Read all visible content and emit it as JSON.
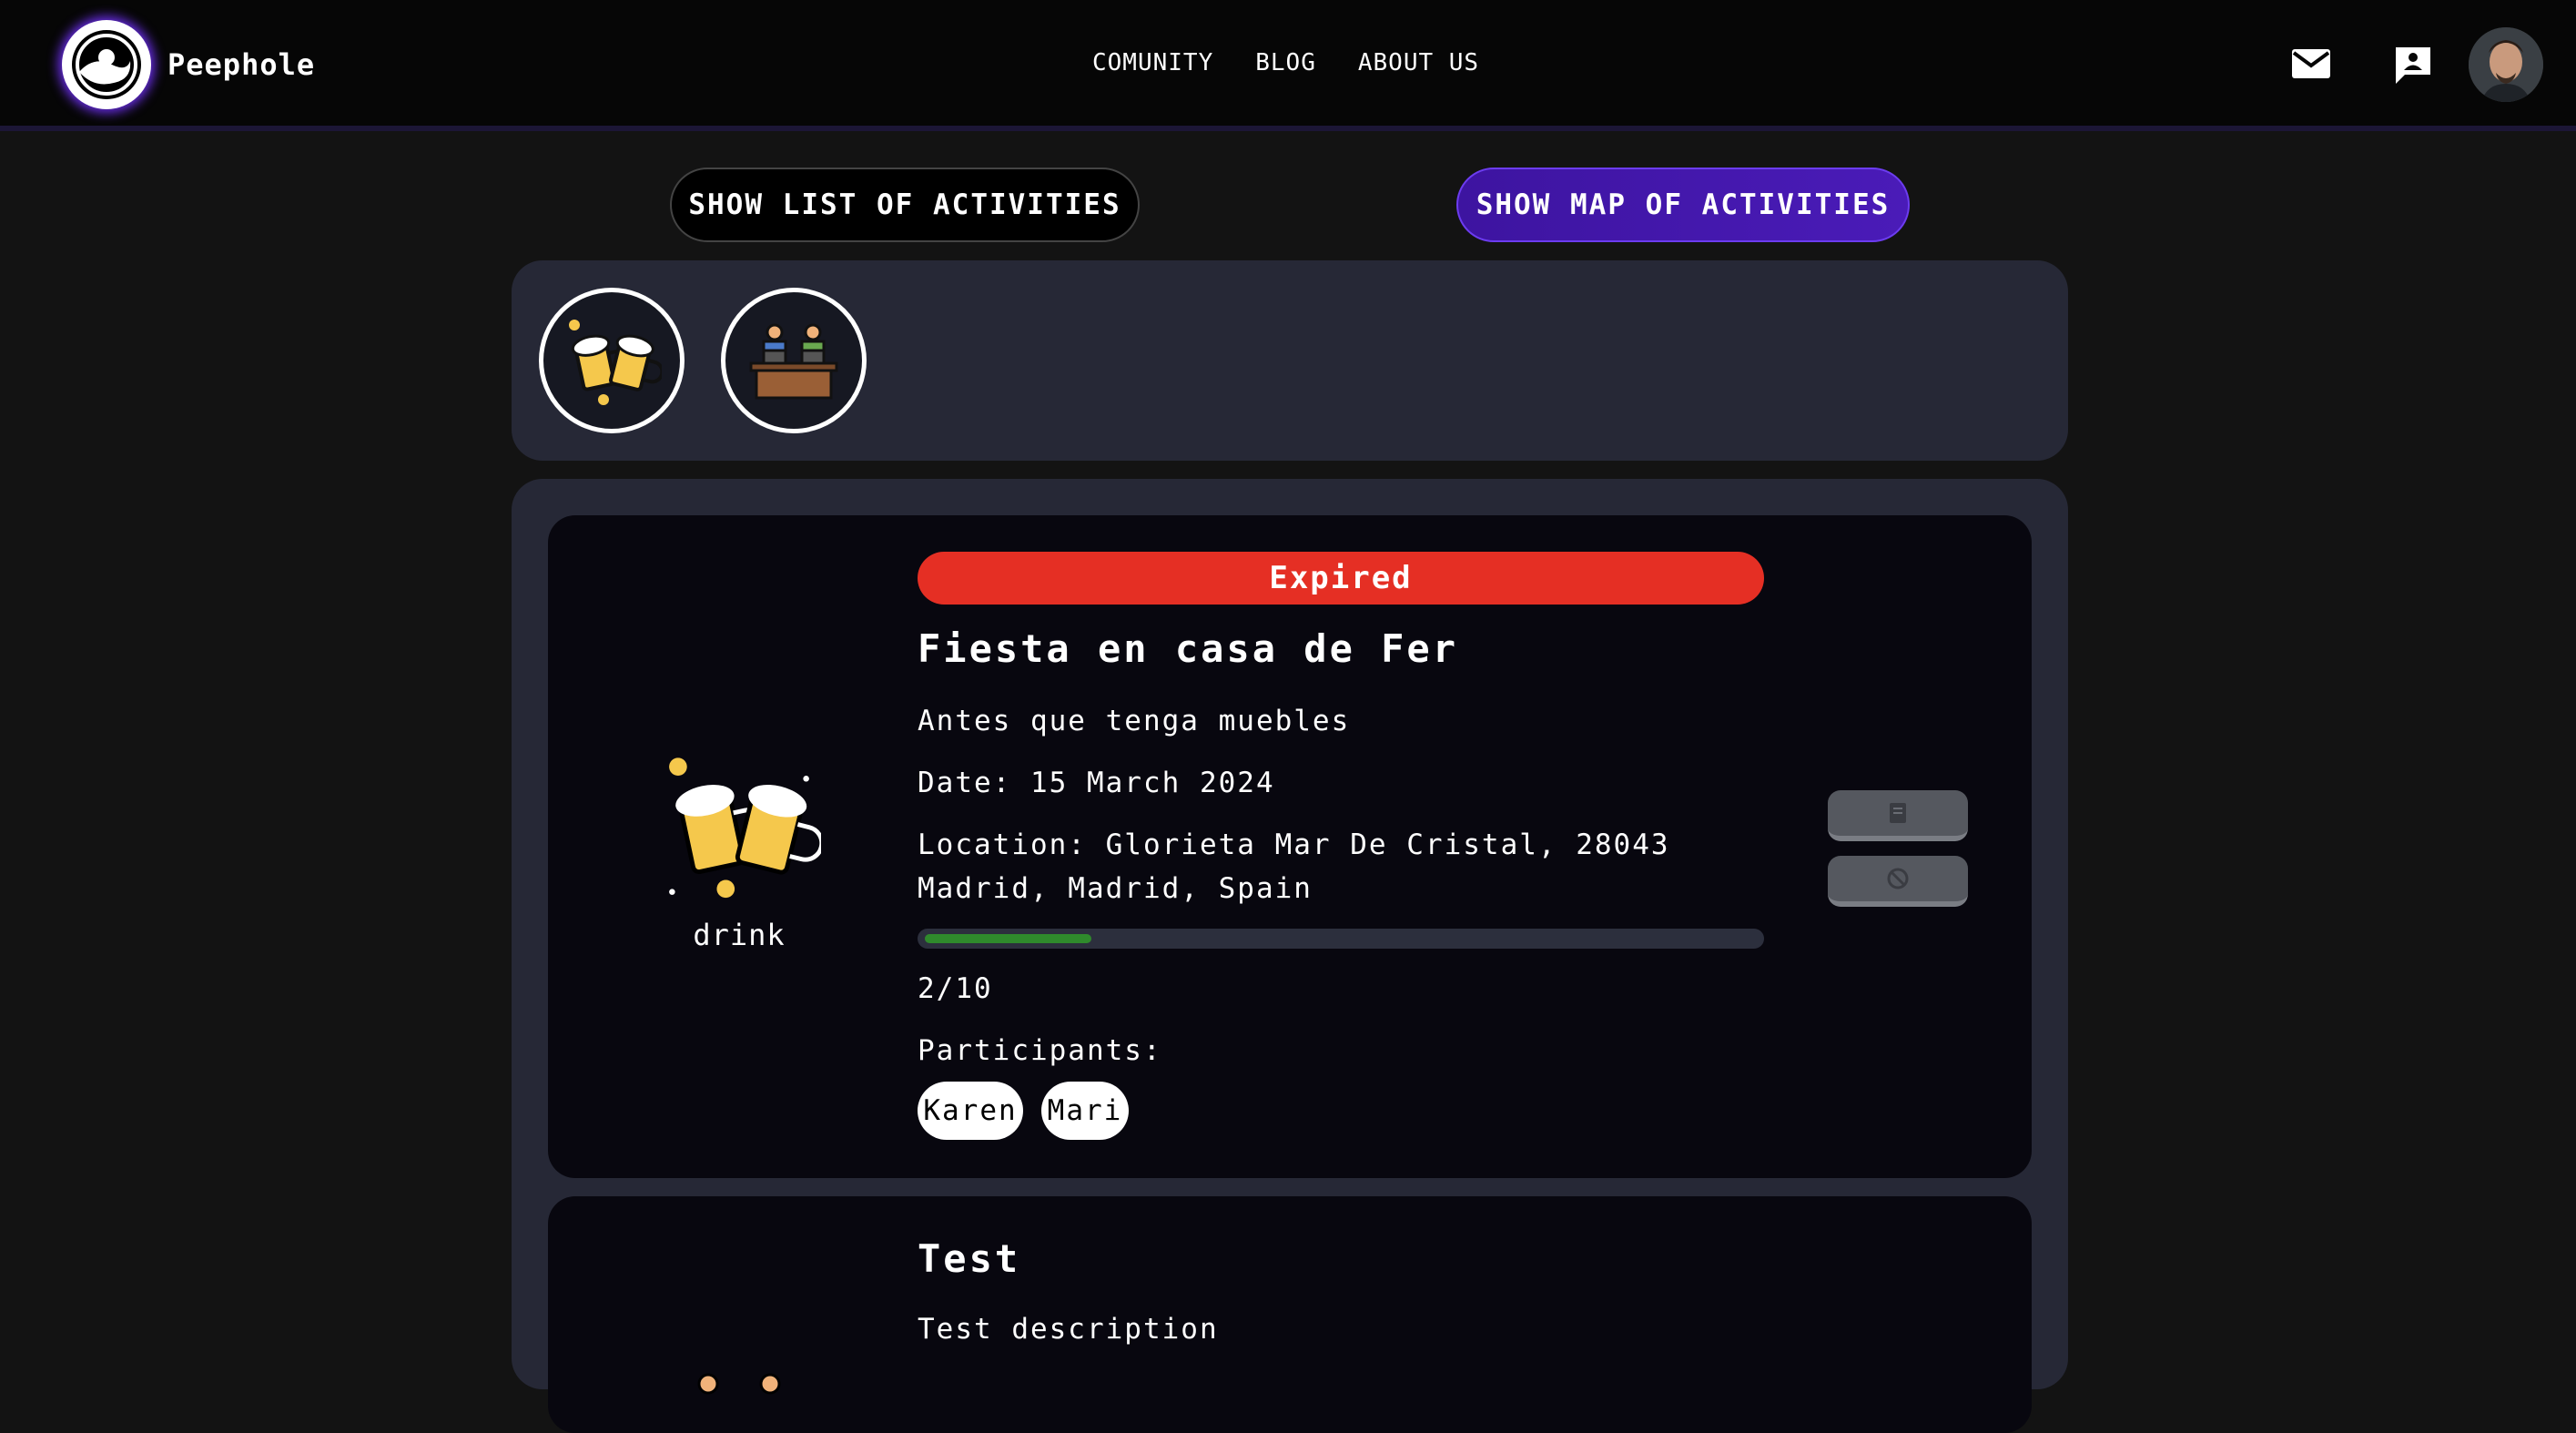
{
  "app": {
    "name": "Peephole"
  },
  "nav": {
    "links": [
      "COMUNITY",
      "BLOG",
      "ABOUT US"
    ]
  },
  "toggle": {
    "list_label": "SHOW LIST OF ACTIVITIES",
    "map_label": "SHOW MAP OF ACTIVITIES"
  },
  "categories": [
    {
      "icon": "beer-mugs-icon"
    },
    {
      "icon": "coworking-desk-icon"
    }
  ],
  "activities": [
    {
      "status": "Expired",
      "title": "Fiesta en casa de Fer",
      "description": "Antes que tenga muebles",
      "date": "Date: 15 March 2024",
      "location": "Location: Glorieta Mar De Cristal, 28043 Madrid, Madrid, Spain",
      "category": "drink",
      "capacity_text": "2/10",
      "capacity_fraction": 0.2,
      "participants_label": "Participants:",
      "participants": [
        "Karen",
        "Mari"
      ]
    },
    {
      "title": "Test",
      "description": "Test description"
    }
  ],
  "colors": {
    "accent": "#4a1bb8",
    "expired": "#e52f24",
    "progress": "#2f8a2c",
    "panel": "#262836",
    "card": "#08070f"
  }
}
